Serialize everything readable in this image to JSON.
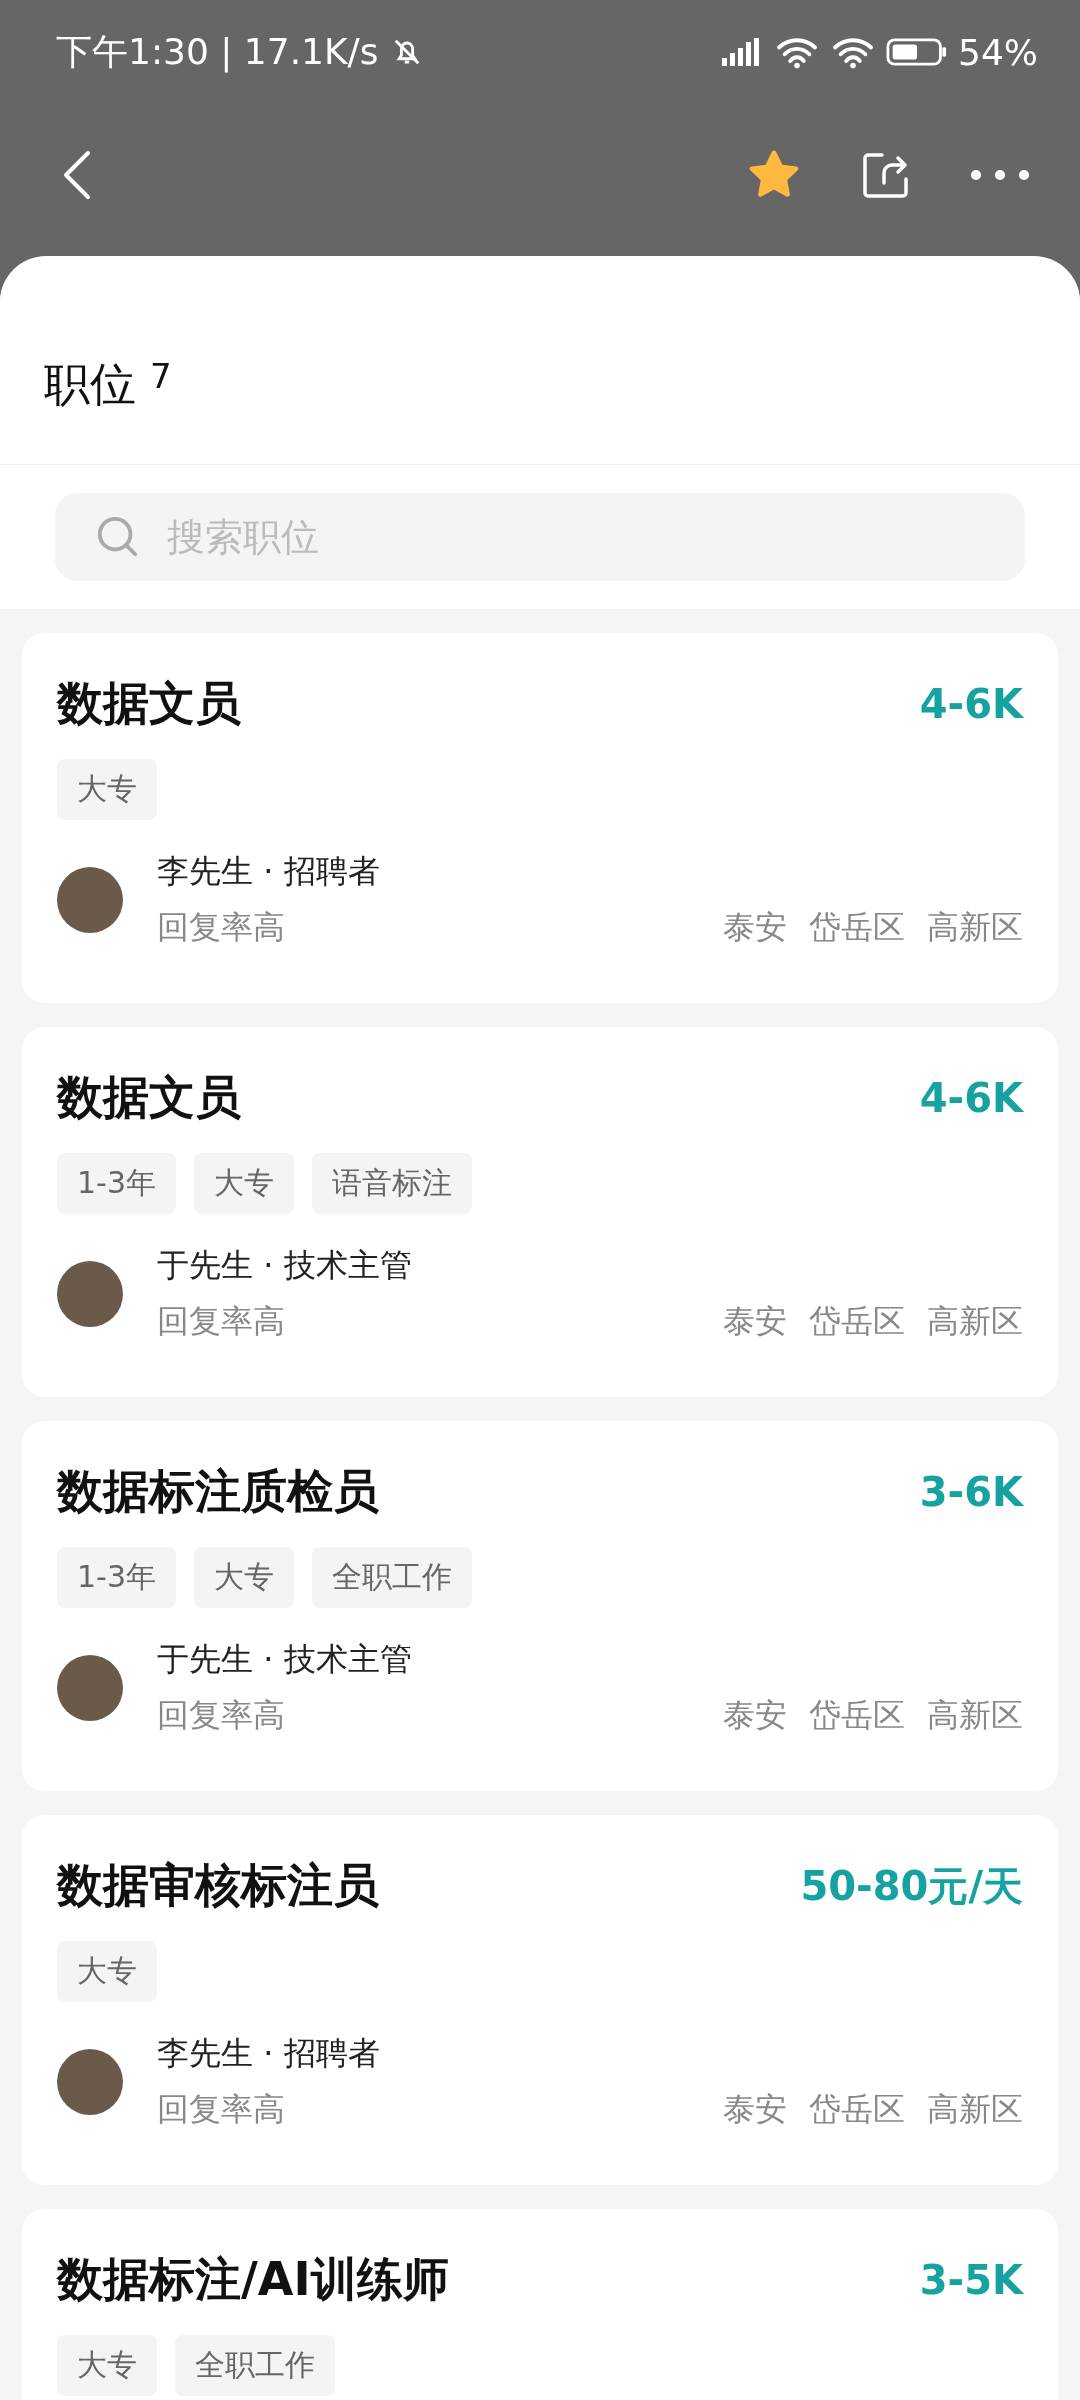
{
  "status_bar": {
    "time_speed": "下午1:30 | 17.1K/s",
    "battery": "54%"
  },
  "header": {
    "favorited": true
  },
  "section": {
    "title": "职位",
    "count": "7"
  },
  "search": {
    "placeholder": "搜索职位"
  },
  "jobs": [
    {
      "title": "数据文员",
      "salary": "4-6K",
      "tags": [
        "大专"
      ],
      "recruiter": "李先生 · 招聘者",
      "reply": "回复率高",
      "location": [
        "泰安",
        "岱岳区",
        "高新区"
      ]
    },
    {
      "title": "数据文员",
      "salary": "4-6K",
      "tags": [
        "1-3年",
        "大专",
        "语音标注"
      ],
      "recruiter": "于先生 · 技术主管",
      "reply": "回复率高",
      "location": [
        "泰安",
        "岱岳区",
        "高新区"
      ]
    },
    {
      "title": "数据标注质检员",
      "salary": "3-6K",
      "tags": [
        "1-3年",
        "大专",
        "全职工作"
      ],
      "recruiter": "于先生 · 技术主管",
      "reply": "回复率高",
      "location": [
        "泰安",
        "岱岳区",
        "高新区"
      ]
    },
    {
      "title": "数据审核标注员",
      "salary": "50-80元/天",
      "tags": [
        "大专"
      ],
      "recruiter": "李先生 · 招聘者",
      "reply": "回复率高",
      "location": [
        "泰安",
        "岱岳区",
        "高新区"
      ]
    },
    {
      "title": "数据标注/AI训练师",
      "salary": "3-5K",
      "tags": [
        "大专",
        "全职工作"
      ]
    }
  ]
}
